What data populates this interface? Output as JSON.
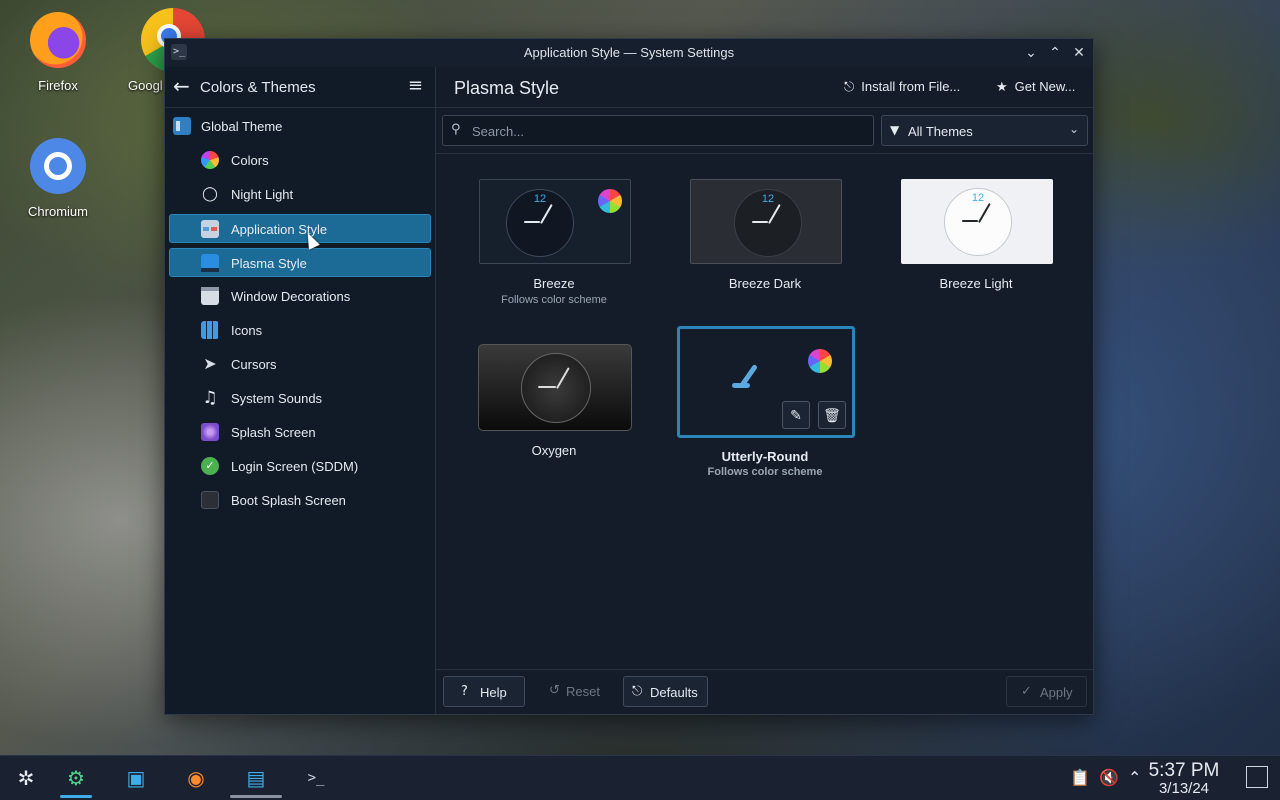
{
  "desktop": {
    "icons": [
      {
        "label": "Firefox"
      },
      {
        "label": "Googl"
      },
      {
        "label": "Chromium"
      }
    ]
  },
  "window": {
    "title": "Application Style — System Settings",
    "sidebar": {
      "header": "Colors & Themes",
      "items": [
        {
          "label": "Global Theme",
          "icon": "global-theme-icon"
        },
        {
          "label": "Colors",
          "icon": "colors-icon"
        },
        {
          "label": "Night Light",
          "icon": "lightbulb-icon"
        },
        {
          "label": "Application Style",
          "icon": "application-style-icon",
          "selected": true
        },
        {
          "label": "Plasma Style",
          "icon": "plasma-style-icon",
          "selected": true
        },
        {
          "label": "Window Decorations",
          "icon": "window-decorations-icon"
        },
        {
          "label": "Icons",
          "icon": "icons-icon"
        },
        {
          "label": "Cursors",
          "icon": "cursor-icon"
        },
        {
          "label": "System Sounds",
          "icon": "music-note-icon"
        },
        {
          "label": "Splash Screen",
          "icon": "splash-screen-icon"
        },
        {
          "label": "Login Screen (SDDM)",
          "icon": "login-screen-icon"
        },
        {
          "label": "Boot Splash Screen",
          "icon": "boot-splash-icon"
        }
      ]
    },
    "main": {
      "title": "Plasma Style",
      "install_label": "Install from File...",
      "get_new_label": "Get New...",
      "search_placeholder": "Search...",
      "filter_value": "All Themes",
      "themes": [
        {
          "name": "Breeze",
          "subtitle": "Follows color scheme"
        },
        {
          "name": "Breeze Dark",
          "subtitle": ""
        },
        {
          "name": "Breeze Light",
          "subtitle": ""
        },
        {
          "name": "Oxygen",
          "subtitle": ""
        },
        {
          "name": "Utterly-Round",
          "subtitle": "Follows color scheme",
          "current": true
        }
      ],
      "clock_numeral": "12"
    },
    "footer": {
      "help": "Help",
      "reset": "Reset",
      "defaults": "Defaults",
      "apply": "Apply"
    }
  },
  "taskbar": {
    "time": "5:37 PM",
    "date": "3/13/24"
  },
  "colors": {
    "accent": "#1c6b97",
    "selection_border": "#2a85b8",
    "window_bg": "#141c2a",
    "sidebar_bg": "#111a27"
  }
}
